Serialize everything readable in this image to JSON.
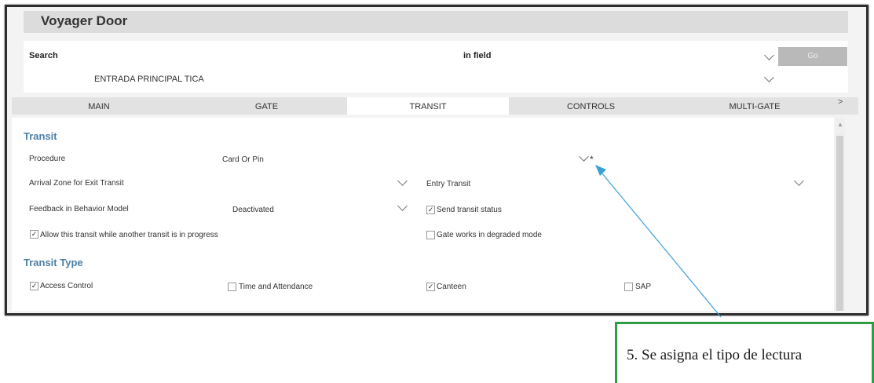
{
  "app": {
    "title": "Voyager Door"
  },
  "search": {
    "label": "Search",
    "in_field_label": "in field",
    "go_label": "Go",
    "value": "ENTRADA PRINCIPAL TICA"
  },
  "tabs": [
    {
      "label": "MAIN",
      "active": false
    },
    {
      "label": "GATE",
      "active": false
    },
    {
      "label": "TRANSIT",
      "active": true
    },
    {
      "label": "CONTROLS",
      "active": false
    },
    {
      "label": "MULTI-GATE",
      "active": false
    }
  ],
  "tab_more": ">",
  "transit": {
    "title": "Transit",
    "procedure_label": "Procedure",
    "procedure_value": "Card Or Pin",
    "required_mark": "*",
    "arrival_zone_label": "Arrival Zone for Exit Transit",
    "entry_transit_label": "Entry Transit",
    "feedback_label": "Feedback in Behavior Model",
    "feedback_value": "Deactivated",
    "send_status": {
      "label": "Send transit status",
      "checked": true
    },
    "allow_transit": {
      "label": "Allow this transit while another transit is in progress",
      "checked": true
    },
    "degraded_mode": {
      "label": "Gate works in degraded mode",
      "checked": false
    }
  },
  "transit_type": {
    "title": "Transit Type",
    "options": [
      {
        "label": "Access Control",
        "checked": true
      },
      {
        "label": "Time and Attendance",
        "checked": false
      },
      {
        "label": "Canteen",
        "checked": true
      },
      {
        "label": "SAP",
        "checked": false
      }
    ]
  },
  "callout": {
    "text": "5.    Se asigna el tipo de lectura"
  },
  "colors": {
    "accent": "#4b7fa6",
    "callout_border": "#2e9e44",
    "arrow": "#3aa0d8"
  }
}
